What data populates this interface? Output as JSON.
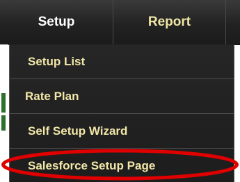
{
  "nav": {
    "tabs": [
      {
        "label": "Setup",
        "active": true
      },
      {
        "label": "Report",
        "active": false
      }
    ]
  },
  "dropdown": {
    "items": [
      {
        "label": "Setup List"
      },
      {
        "label": "Rate Plan"
      },
      {
        "label": "Self Setup Wizard"
      },
      {
        "label": "Salesforce Setup Page",
        "highlighted": true
      }
    ]
  },
  "colors": {
    "menu_text": "#f2e7a8",
    "menu_bg": "#222222",
    "highlight": "#e00000"
  }
}
